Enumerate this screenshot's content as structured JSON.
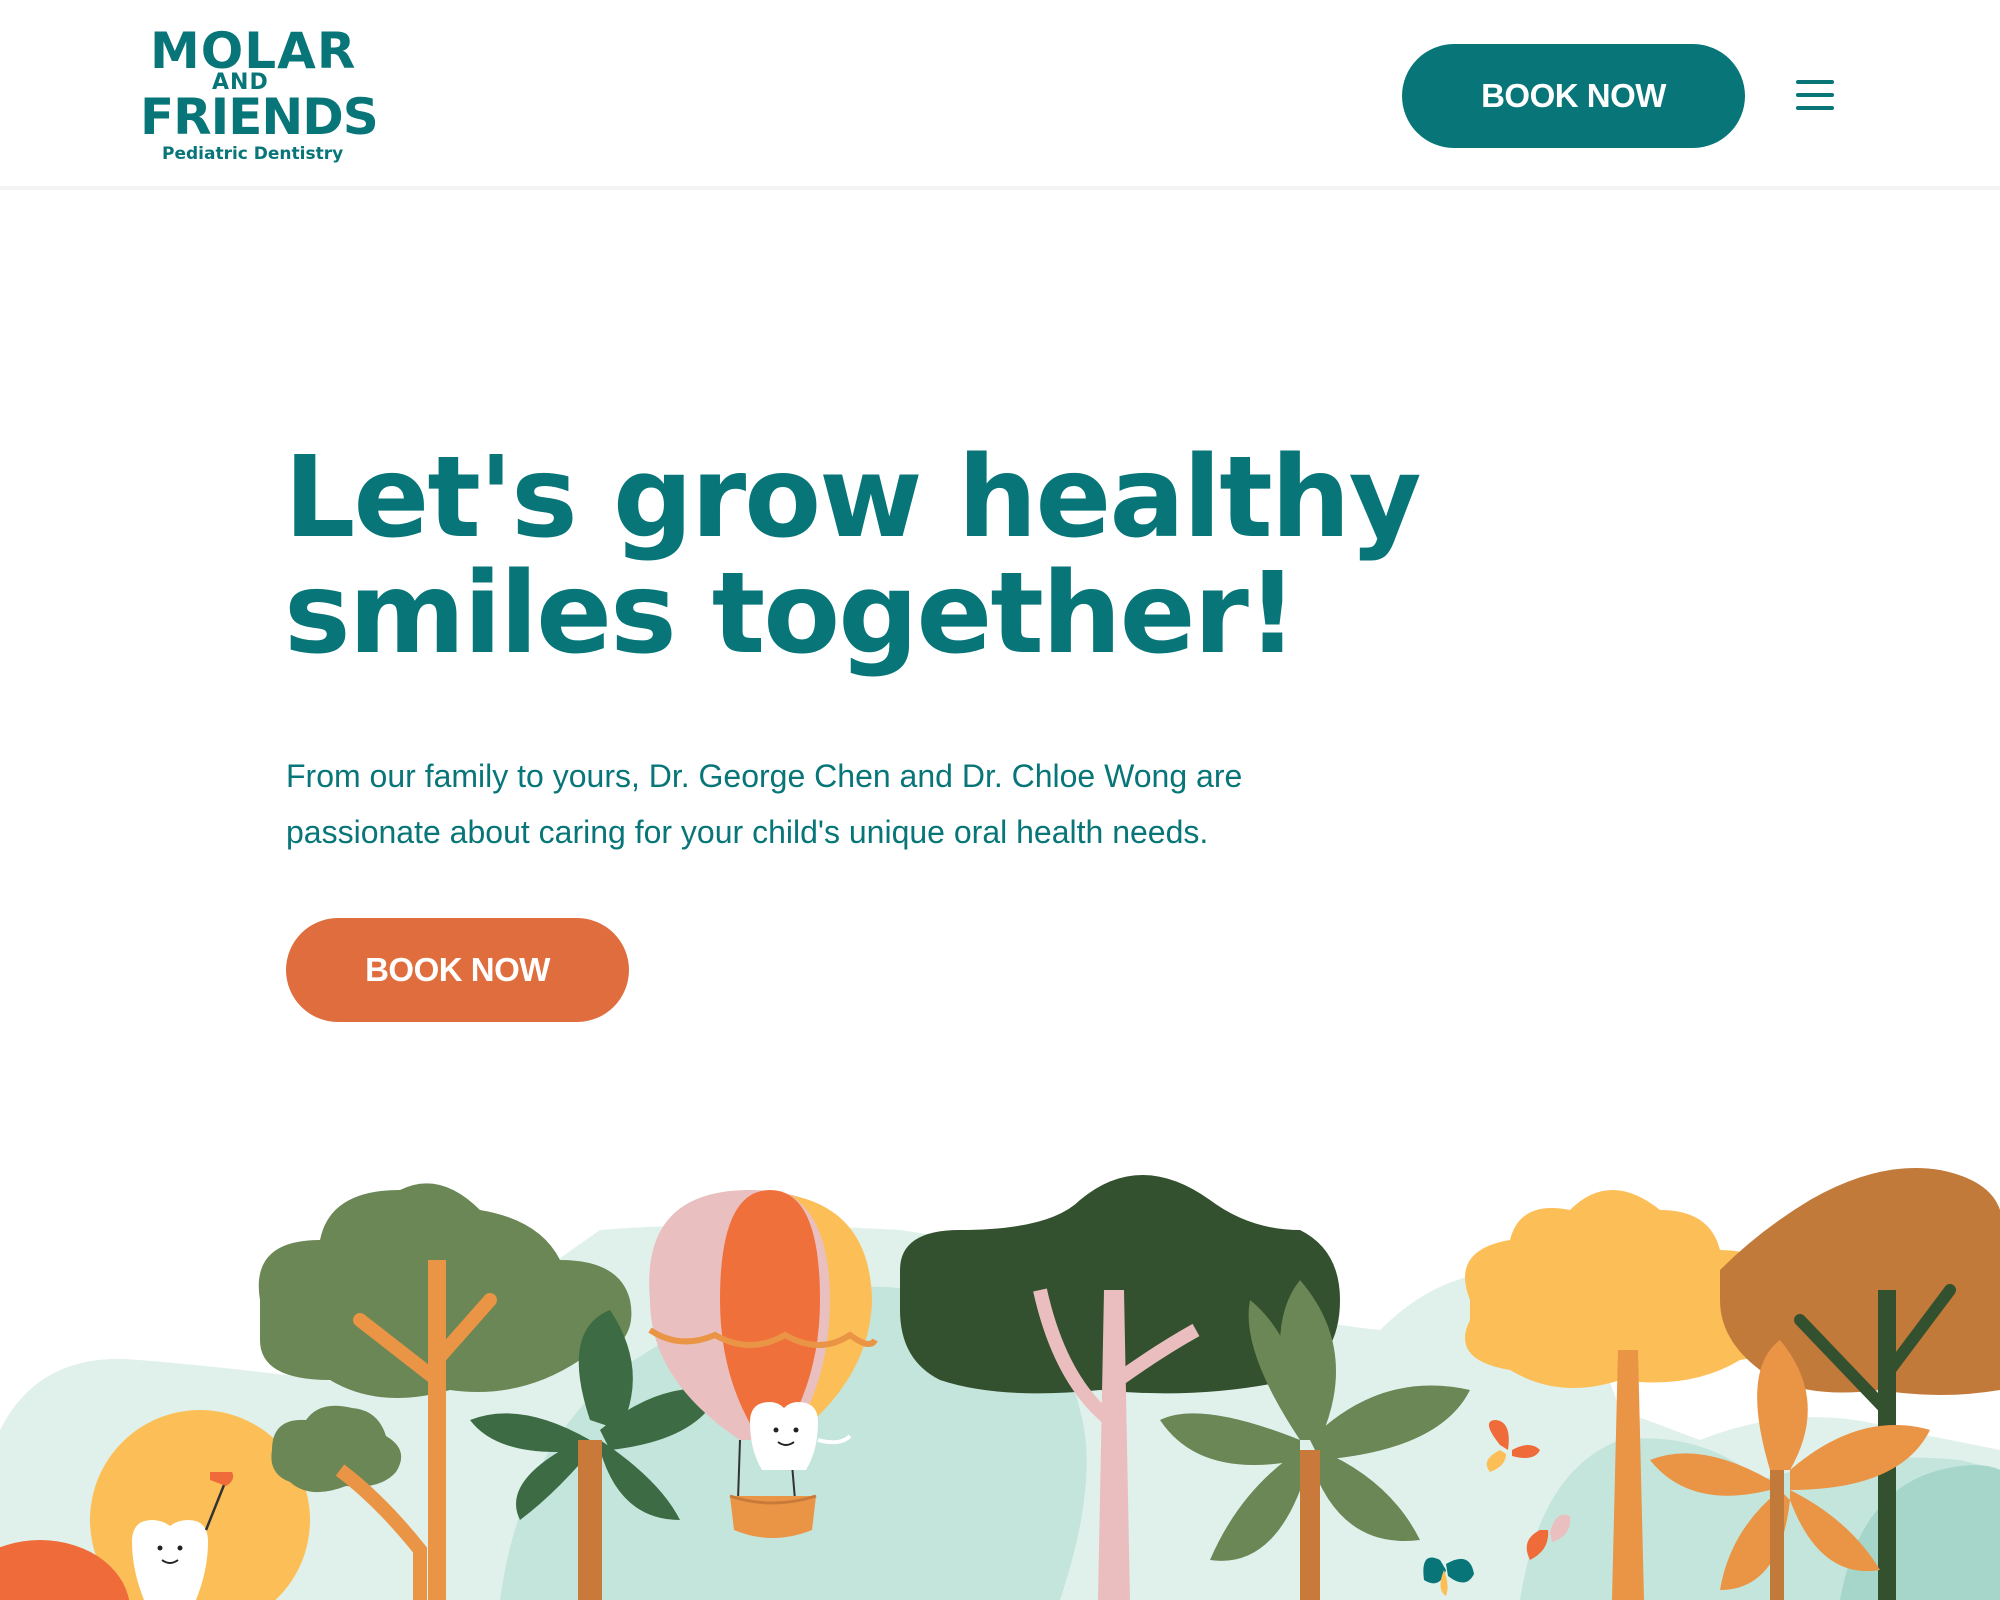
{
  "header": {
    "logo": {
      "line1": "MOLAR",
      "line2": "AND",
      "line3": "FRIENDS",
      "tagline": "Pediatric Dentistry"
    },
    "book_button": "BOOK NOW",
    "menu_icon": "hamburger-menu-icon"
  },
  "hero": {
    "title_line1": "Let's grow healthy",
    "title_line2": "smiles together!",
    "text_line1": "From our family to yours, Dr. George Chen and Dr. Chloe Wong are",
    "text_line2": "passionate about caring for your child's unique oral health needs.",
    "book_button": "BOOK NOW"
  },
  "colors": {
    "brand_teal": "#087678",
    "accent_orange": "#e06d3d",
    "background": "#ffffff"
  },
  "illustration": {
    "icons": [
      "tree-icon",
      "hot-air-balloon-icon",
      "tooth-character-icon",
      "butterfly-icon",
      "sun-icon"
    ]
  }
}
